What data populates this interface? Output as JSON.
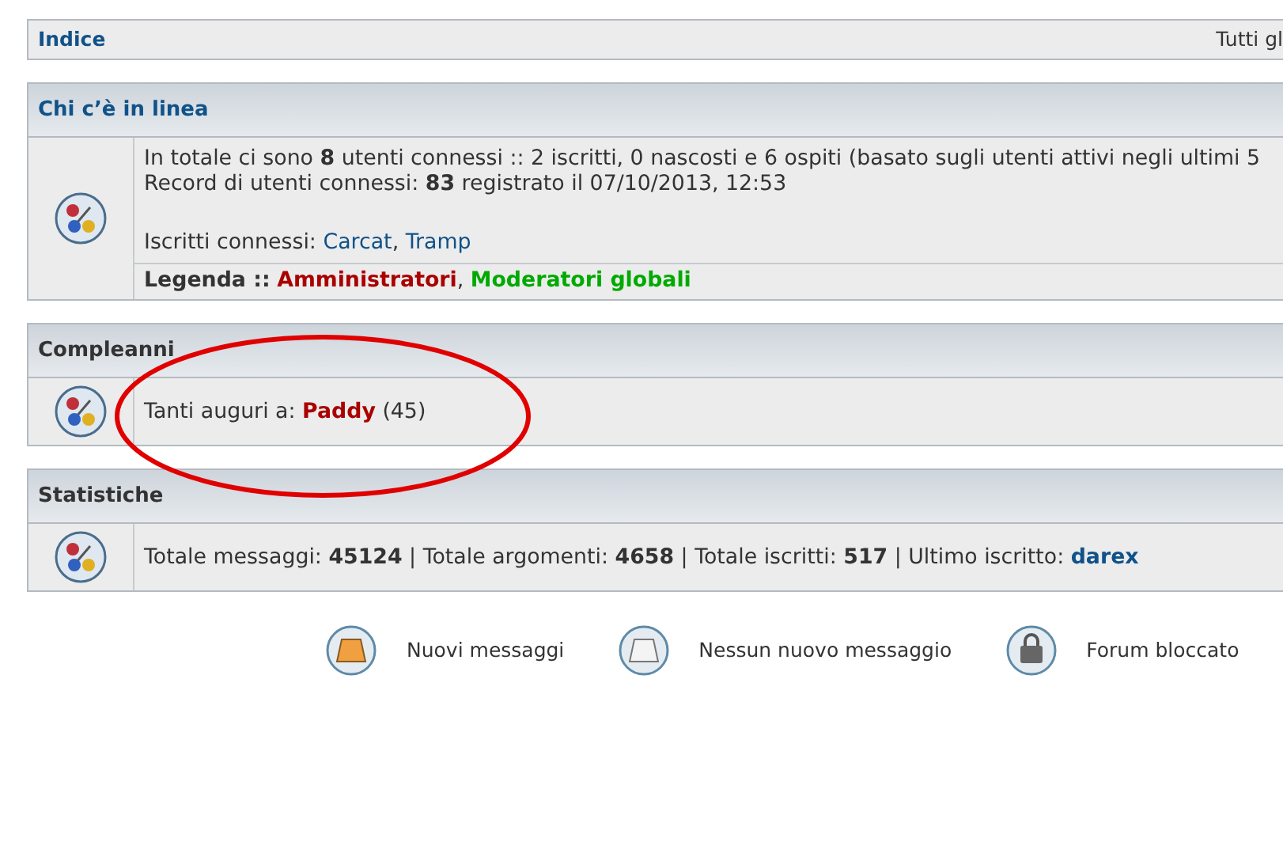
{
  "navbar": {
    "home_link": "Indice",
    "right_text": "Tutti gl"
  },
  "panels": [
    {
      "title": "Chi c’è in linea",
      "rows": [
        {
          "kind": "plain",
          "lines": [
            {
              "parts": [
                {
                  "kind": "text",
                  "text": "In totale ci sono **8** utenti connessi :: 2 iscritti, 0 nascosti e 6 ospiti (basato sugli utenti attivi negli ultimi 5"
                }
              ]
            },
            {
              "parts": [
                {
                  "kind": "text",
                  "text": "Record di utenti connessi: **83** registrato il 07/10/2013, 12:53"
                }
              ]
            }
          ]
        },
        {
          "kind": "plain",
          "lines": [
            {
              "parts": [
                {
                  "kind": "text",
                  "text": "Iscritti connessi:"
                },
                {
                  "kind": "link",
                  "text": "Carcat",
                  "color": "#105289"
                },
                {
                  "kind": "text",
                  "text": ","
                },
                {
                  "kind": "link",
                  "text": "Tramp",
                  "color": "#105289"
                }
              ]
            }
          ]
        },
        {
          "kind": "legend",
          "lines": [
            {
              "parts": [
                {
                  "kind": "text",
                  "text": "**Legenda ::**"
                },
                {
                  "kind": "link",
                  "text": "Amministratori",
                  "color": "#aa0000"
                },
                {
                  "kind": "text",
                  "text": ","
                },
                {
                  "kind": "link",
                  "text": "Moderatori globali",
                  "color": "#00aa00"
                }
              ]
            }
          ]
        }
      ]
    },
    {
      "title": "Compleanni",
      "rows": [
        {
          "kind": "plain",
          "lines": [
            {
              "parts": [
                {
                  "kind": "text",
                  "text": "Tanti auguri a:"
                },
                {
                  "kind": "link",
                  "text": "Paddy",
                  "color": "#aa0000"
                },
                {
                  "kind": "text",
                  "text": "(45)"
                }
              ]
            }
          ]
        }
      ]
    },
    {
      "title": "Statistiche",
      "rows": [
        {
          "kind": "plain",
          "lines": [
            {
              "parts": [
                {
                  "kind": "text",
                  "text": "Totale messaggi: **45124** | Totale argomenti: **4658** | Totale iscritti: **517** | Ultimo iscritto:"
                },
                {
                  "kind": "link",
                  "text": "darex",
                  "color": "#105289"
                }
              ]
            }
          ]
        }
      ]
    }
  ],
  "legend": [
    {
      "kind": "new",
      "label": "Nuovi messaggi"
    },
    {
      "kind": "none",
      "label": "Nessun nuovo messaggio"
    },
    {
      "kind": "locked",
      "label": "Forum bloccato"
    }
  ],
  "highlight_ellipse": {
    "color": "#e00000"
  }
}
